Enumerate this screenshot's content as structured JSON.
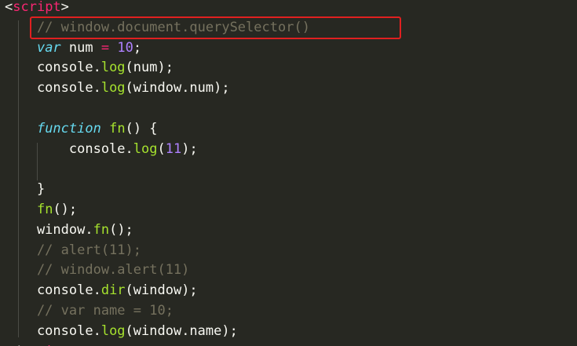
{
  "editor": {
    "lines": [
      {
        "parts": [
          {
            "t": "<",
            "c": "plain"
          },
          {
            "t": "script",
            "c": "tag"
          },
          {
            "t": ">",
            "c": "plain"
          }
        ]
      },
      {
        "parts": [
          {
            "t": "    // window.document.querySelector()",
            "c": "comment"
          }
        ]
      },
      {
        "parts": [
          {
            "t": "    ",
            "c": "plain"
          },
          {
            "t": "var",
            "c": "kw"
          },
          {
            "t": " num ",
            "c": "plain"
          },
          {
            "t": "=",
            "c": "op"
          },
          {
            "t": " ",
            "c": "plain"
          },
          {
            "t": "10",
            "c": "num"
          },
          {
            "t": ";",
            "c": "plain"
          }
        ]
      },
      {
        "parts": [
          {
            "t": "    console.",
            "c": "plain"
          },
          {
            "t": "log",
            "c": "fn"
          },
          {
            "t": "(num);",
            "c": "plain"
          }
        ]
      },
      {
        "parts": [
          {
            "t": "    console.",
            "c": "plain"
          },
          {
            "t": "log",
            "c": "fn"
          },
          {
            "t": "(window.num);",
            "c": "plain"
          }
        ]
      },
      {
        "parts": []
      },
      {
        "parts": [
          {
            "t": "    ",
            "c": "plain"
          },
          {
            "t": "function",
            "c": "kw"
          },
          {
            "t": " ",
            "c": "plain"
          },
          {
            "t": "fn",
            "c": "fn"
          },
          {
            "t": "() {",
            "c": "plain"
          }
        ]
      },
      {
        "parts": [
          {
            "t": "        console.",
            "c": "plain"
          },
          {
            "t": "log",
            "c": "fn"
          },
          {
            "t": "(",
            "c": "plain"
          },
          {
            "t": "11",
            "c": "num"
          },
          {
            "t": ");",
            "c": "plain"
          }
        ]
      },
      {
        "parts": []
      },
      {
        "parts": [
          {
            "t": "    }",
            "c": "plain"
          }
        ]
      },
      {
        "parts": [
          {
            "t": "    ",
            "c": "plain"
          },
          {
            "t": "fn",
            "c": "fn"
          },
          {
            "t": "();",
            "c": "plain"
          }
        ]
      },
      {
        "parts": [
          {
            "t": "    window.",
            "c": "plain"
          },
          {
            "t": "fn",
            "c": "fn"
          },
          {
            "t": "();",
            "c": "plain"
          }
        ]
      },
      {
        "parts": [
          {
            "t": "    // alert(11);",
            "c": "comment"
          }
        ]
      },
      {
        "parts": [
          {
            "t": "    // window.alert(11)",
            "c": "comment"
          }
        ]
      },
      {
        "parts": [
          {
            "t": "    console.",
            "c": "plain"
          },
          {
            "t": "dir",
            "c": "fn"
          },
          {
            "t": "(window);",
            "c": "plain"
          }
        ]
      },
      {
        "parts": [
          {
            "t": "    // var name = 10;",
            "c": "comment"
          }
        ]
      },
      {
        "parts": [
          {
            "t": "    console.",
            "c": "plain"
          },
          {
            "t": "log",
            "c": "fn"
          },
          {
            "t": "(window.name);",
            "c": "plain"
          }
        ]
      },
      {
        "parts": [
          {
            "t": "</",
            "c": "plain"
          },
          {
            "t": "script",
            "c": "tag"
          },
          {
            "t": ">",
            "c": "plain"
          }
        ]
      }
    ]
  },
  "colors": {
    "background": "#272822",
    "text": "#f8f8f2",
    "tag": "#f92672",
    "keyword": "#66d9ef",
    "number": "#ae81ff",
    "function": "#a6e22e",
    "comment": "#75715e",
    "highlight_box": "#e02020"
  }
}
